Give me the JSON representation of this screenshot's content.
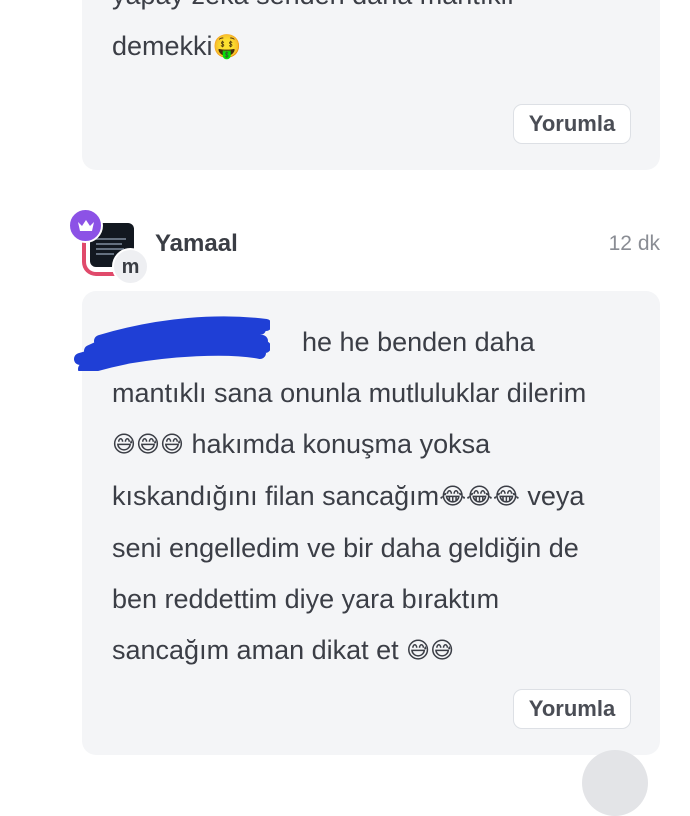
{
  "comments": [
    {
      "text_lines": [
        "yapay zeka senden daha mantıklı",
        "demekki"
      ],
      "emojis": {
        "line2": "🤑"
      },
      "reply_label": "Yorumla"
    },
    {
      "author": "Yamaal",
      "time": "12 dk",
      "badge_letter": "m",
      "text_lines": [
        "he he benden daha",
        "mantıklı sana onunla mutluluklar dilerim",
        "hakımda konuşma yoksa",
        "kıskandığını filan sancağım",
        "veya",
        "seni engelledim ve bir daha geldiğin de",
        "ben reddettim diye yara bıraktım",
        "sancağım aman dikat et"
      ],
      "emojis": {
        "sweat_smile_triple": "😅😅😅",
        "joy_triple": "😂😂😂",
        "sweat_smile_double": "😅😅"
      },
      "reply_label": "Yorumla"
    }
  ],
  "colors": {
    "card_bg": "#f4f5f7",
    "crown_badge": "#8c52e6",
    "avatar_ring": "#e04a6b",
    "redaction": "#1f3fd6"
  },
  "icons": {
    "crown": "crown-icon",
    "redaction": "redaction-scribble"
  }
}
